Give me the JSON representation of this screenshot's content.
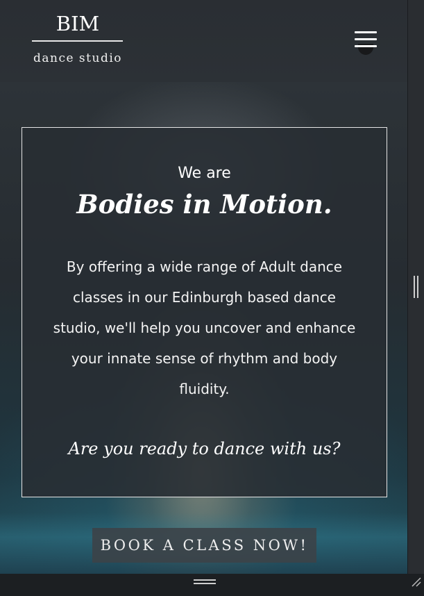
{
  "header": {
    "logo_title": "BIM",
    "logo_subtitle": "dance studio",
    "menu_icon": "hamburger-menu-icon"
  },
  "hero": {
    "intro": "We are",
    "headline": "Bodies in Motion.",
    "description": "By offering a wide range of Adult dance classes in our Edinburgh based dance studio, we'll help you uncover and enhance your innate sense of rhythm and body fluidity.",
    "question": "Are you ready to dance with us?",
    "cta_label": "BOOK A CLASS NOW!"
  },
  "colors": {
    "overlay": "#282e33",
    "text": "#ffffff",
    "button_bg": "#3c4248"
  }
}
